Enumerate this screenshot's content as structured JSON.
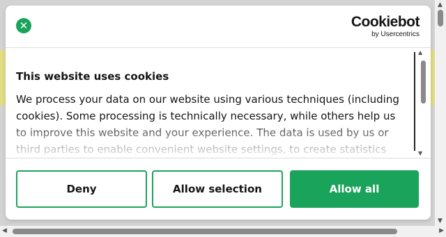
{
  "dialog": {
    "close_symbol": "✕",
    "logo": {
      "main": "Cookiebot",
      "sub": "by Usercentrics"
    },
    "title": "This website uses cookies",
    "body_text": "We process your data on our website using various techniques (including cookies). Some processing is technically necessary, while others help us to improve this website and your experience. The data is used by us or third parties to enable convenient website settings, to create statistics and",
    "buttons": {
      "deny": "Deny",
      "allow_selection": "Allow selection",
      "allow_all": "Allow all"
    }
  },
  "colors": {
    "accent": "#1aa35a",
    "backdrop_band": "#e2dc86"
  },
  "icons": {
    "close": "close-icon",
    "scroll_up": "▲",
    "scroll_down": "▼",
    "scroll_left": "◀",
    "scroll_right": "▶"
  }
}
